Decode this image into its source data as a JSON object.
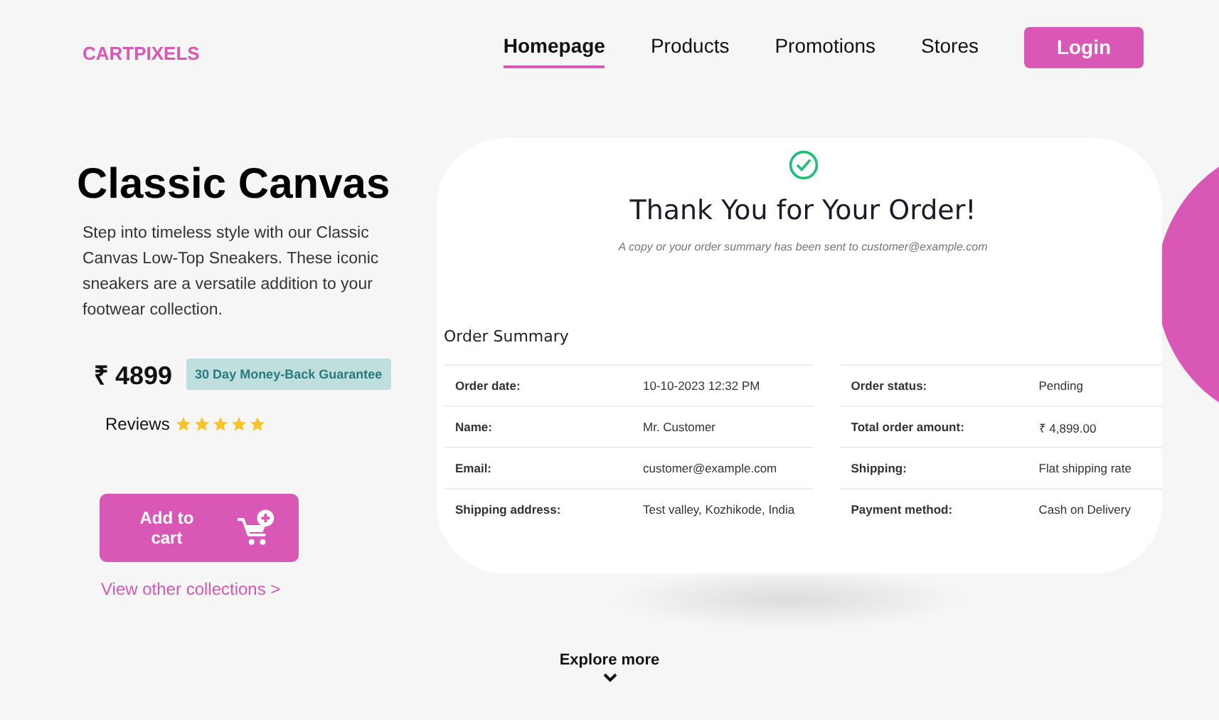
{
  "header": {
    "logo": "CARTPIXELS",
    "nav": [
      {
        "label": "Homepage",
        "selected": true
      },
      {
        "label": "Products",
        "selected": false
      },
      {
        "label": "Promotions",
        "selected": false
      },
      {
        "label": "Stores",
        "selected": false
      }
    ],
    "login": "Login"
  },
  "product": {
    "title": "Classic Canvas",
    "description": "Step into timeless style with our Classic Canvas Low-Top Sneakers. These iconic sneakers are a versatile addition to your footwear collection.",
    "price": "₹ 4899",
    "guarantee": "30 Day Money-Back Guarantee",
    "reviews_label": "Reviews",
    "stars": 5,
    "add_to_cart": "Add to cart",
    "view_other": "View other collections >"
  },
  "confirmation": {
    "title": "Thank You for Your Order!",
    "note": "A copy or your order summary has been sent to customer@example.com",
    "summary_title": "Order Summary",
    "tables": [
      [
        {
          "label": "Order date:",
          "value": "10-10-2023 12:32 PM"
        },
        {
          "label": "Name:",
          "value": "Mr. Customer"
        },
        {
          "label": "Email:",
          "value": "customer@example.com"
        },
        {
          "label": "Shipping address:",
          "value": "Test valley, Kozhikode, India"
        }
      ],
      [
        {
          "label": "Order status:",
          "value": "Pending"
        },
        {
          "label": "Total order amount:",
          "value": "₹ 4,899.00"
        },
        {
          "label": "Shipping:",
          "value": "Flat shipping rate"
        },
        {
          "label": "Payment method:",
          "value": "Cash on Delivery"
        }
      ]
    ]
  },
  "explore": "Explore more"
}
